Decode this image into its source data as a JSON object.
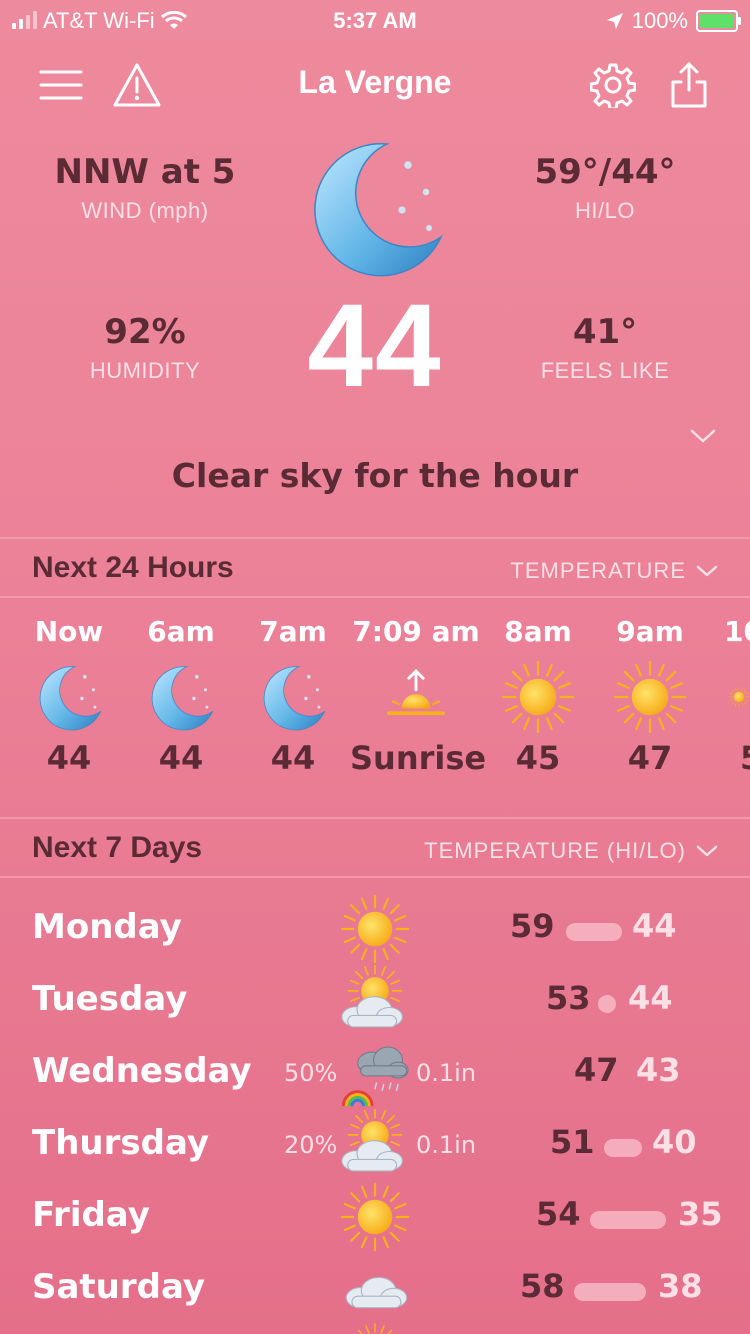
{
  "status": {
    "carrier": "AT&T Wi-Fi",
    "time": "5:37 AM",
    "battery": "100%"
  },
  "header": {
    "city": "La Vergne"
  },
  "current": {
    "wind_value": "NNW at 5",
    "wind_label": "WIND (mph)",
    "hilo_value": "59°/44°",
    "hilo_label": "HI/LO",
    "humidity_value": "92%",
    "humidity_label": "HUMIDITY",
    "feels_value": "41°",
    "feels_label": "FEELS LIKE",
    "temperature": "44",
    "summary": "Clear sky for the hour"
  },
  "hourly": {
    "title": "Next 24 Hours",
    "selector": "TEMPERATURE",
    "items": [
      {
        "time": "Now",
        "icon": "moon-icon",
        "value": "44"
      },
      {
        "time": "6am",
        "icon": "moon-icon",
        "value": "44"
      },
      {
        "time": "7am",
        "icon": "moon-icon",
        "value": "44"
      },
      {
        "time": "7:09 am",
        "icon": "sunrise-icon",
        "value": "Sunrise"
      },
      {
        "time": "8am",
        "icon": "sun-icon",
        "value": "45"
      },
      {
        "time": "9am",
        "icon": "sun-icon",
        "value": "47"
      },
      {
        "time": "10",
        "icon": "sun-icon",
        "value": "5"
      }
    ]
  },
  "daily": {
    "title": "Next 7 Days",
    "selector": "TEMPERATURE (HI/LO)",
    "items": [
      {
        "day": "Monday",
        "icon": "sun-icon",
        "precip": "",
        "amount": "",
        "hi": "59",
        "lo": "44"
      },
      {
        "day": "Tuesday",
        "icon": "partly-cloudy-icon",
        "precip": "",
        "amount": "",
        "hi": "53",
        "lo": "44"
      },
      {
        "day": "Wednesday",
        "icon": "rain-rainbow-icon",
        "precip": "50%",
        "amount": "0.1in",
        "hi": "47",
        "lo": "43"
      },
      {
        "day": "Thursday",
        "icon": "partly-cloudy-icon",
        "precip": "20%",
        "amount": "0.1in",
        "hi": "51",
        "lo": "40"
      },
      {
        "day": "Friday",
        "icon": "sun-icon",
        "precip": "",
        "amount": "",
        "hi": "54",
        "lo": "35"
      },
      {
        "day": "Saturday",
        "icon": "cloud-icon",
        "precip": "",
        "amount": "",
        "hi": "58",
        "lo": "38"
      }
    ]
  },
  "colors": {
    "background": "#eb8198",
    "dark_text": "#5a2a35",
    "light_text": "#fbe0e6",
    "sun": "#f6b21b",
    "moon": "#5fb4e6"
  }
}
